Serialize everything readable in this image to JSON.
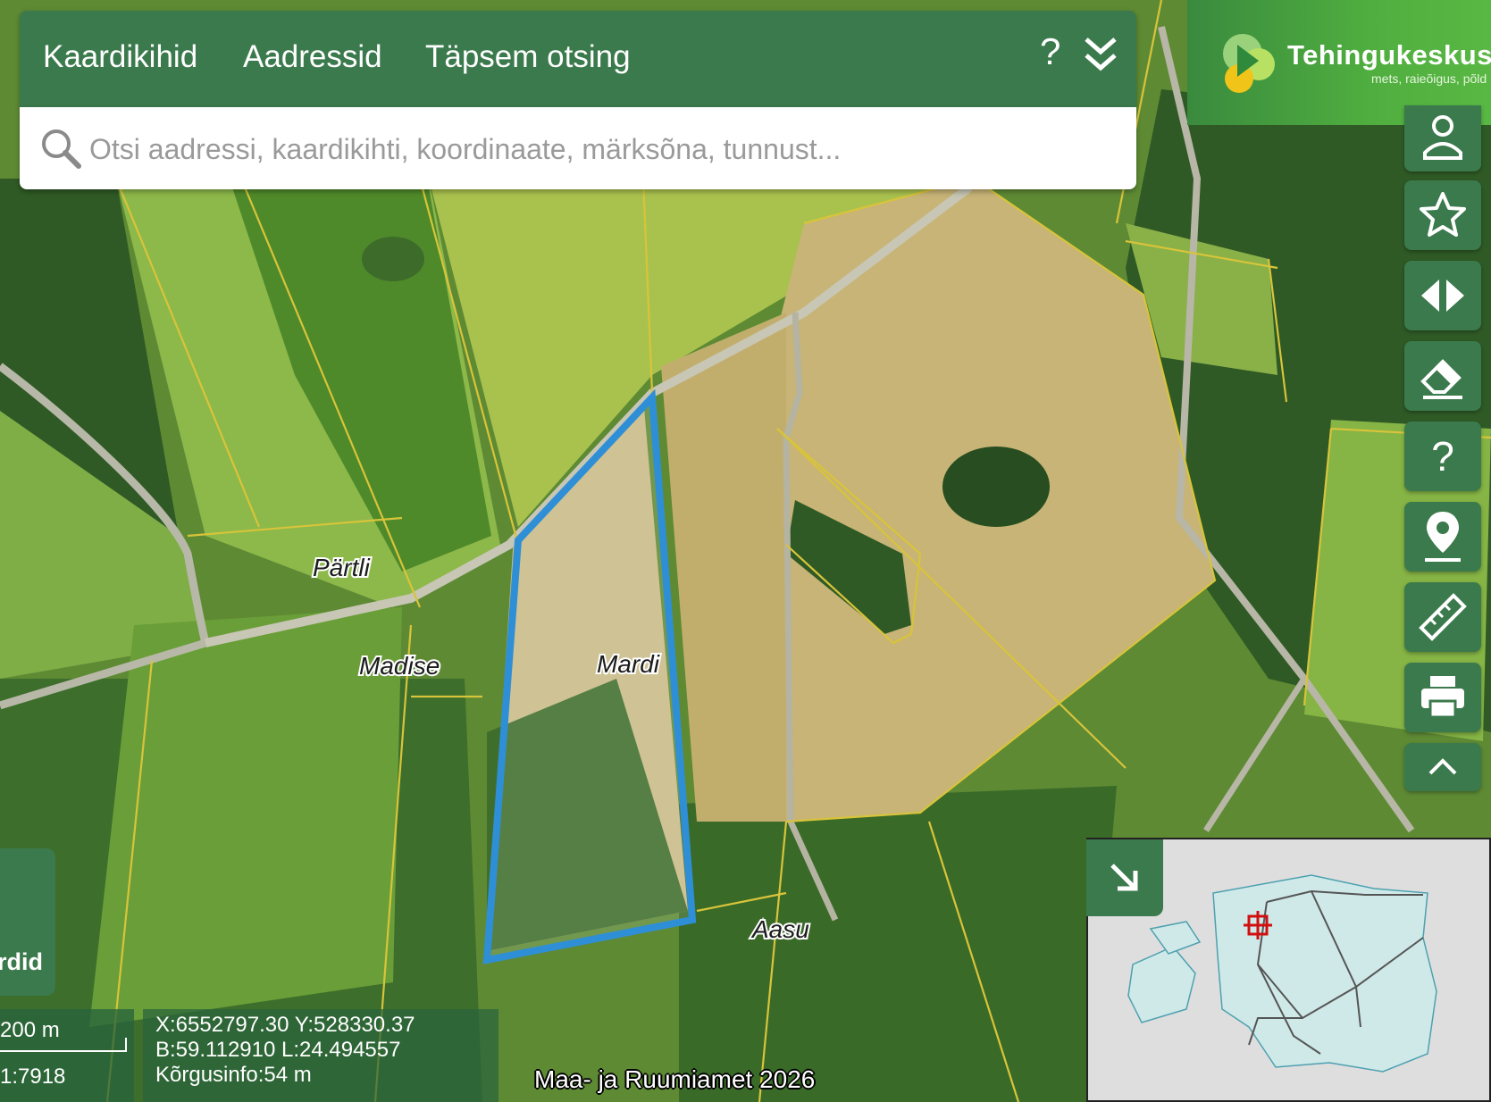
{
  "toolbar": {
    "tabs": [
      "Kaardikihid",
      "Aadressid",
      "Täpsem otsing"
    ],
    "help_icon": "question-icon",
    "collapse_icon": "double-chevron-down-icon"
  },
  "search": {
    "placeholder": "Otsi aadressi, kaardikihti, koordinaate, märksõna, tunnust..."
  },
  "logo": {
    "title": "Tehingukeskus",
    "subtitle": "mets, raieõigus, põld"
  },
  "side_tools": [
    "user-icon",
    "star-icon",
    "compare-icon",
    "eraser-icon",
    "help-icon",
    "location-pin-icon",
    "ruler-icon",
    "print-icon",
    "chevron-up-icon"
  ],
  "map": {
    "place_labels": [
      "Pärtli",
      "Madise",
      "Mardi",
      "Aasu"
    ],
    "highlight_color": "#2f8fd6",
    "boundary_color": "#d8c43a"
  },
  "left_panel": {
    "label": "ardid"
  },
  "scale": {
    "distance": "200 m",
    "ratio": "1:7918"
  },
  "coordinates": {
    "xy": "X:6552797.30 Y:528330.37",
    "bl": "B:59.112910 L:24.494557",
    "height": "Kõrgusinfo:54 m"
  },
  "attribution": "Maa- ja Ruumiamet 2026",
  "colors": {
    "panel_green": "#3b7a4c",
    "logo_green": "#4fae3f"
  }
}
